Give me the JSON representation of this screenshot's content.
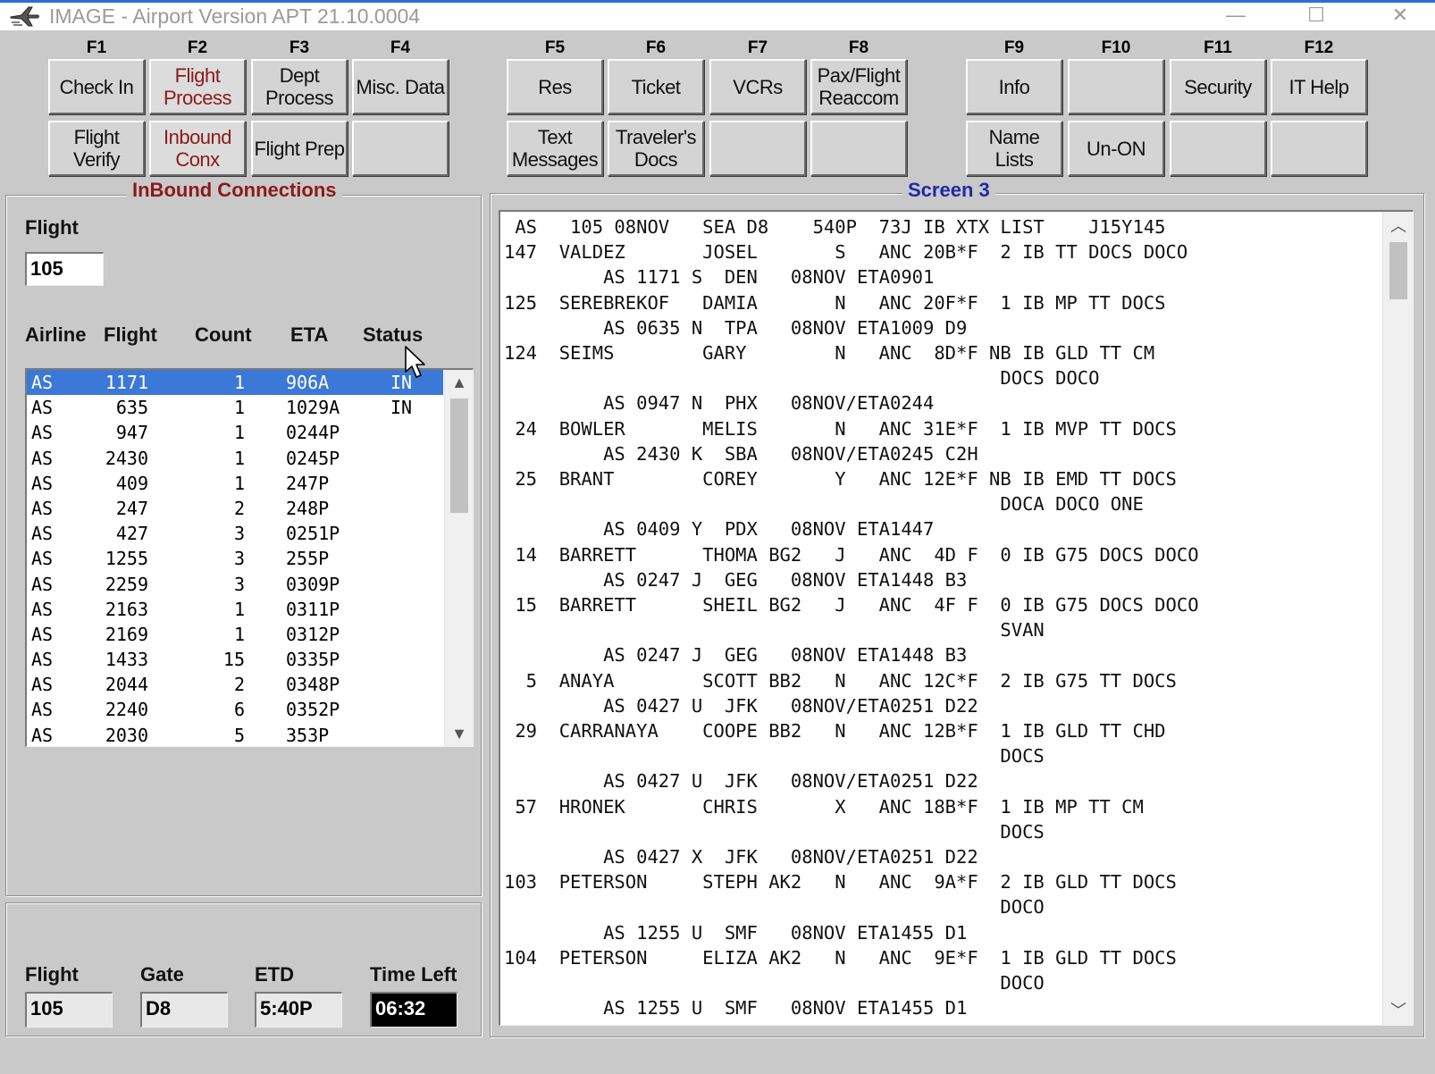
{
  "window": {
    "title": "IMAGE - Airport Version APT 21.10.0004",
    "controls": {
      "minimize": "—",
      "maximize": "☐",
      "close": "✕"
    }
  },
  "function_keys": [
    {
      "key": "F1",
      "top": "Check In",
      "bottom": "Flight\nVerify"
    },
    {
      "key": "F2",
      "top": "Flight\nProcess",
      "bottom": "Inbound\nConx",
      "active": true
    },
    {
      "key": "F3",
      "top": "Dept\nProcess",
      "bottom": "Flight Prep"
    },
    {
      "key": "F4",
      "top": "Misc. Data",
      "bottom": ""
    },
    {
      "key": "F5",
      "top": "Res",
      "bottom": "Text\nMessages"
    },
    {
      "key": "F6",
      "top": "Ticket",
      "bottom": "Traveler's\nDocs"
    },
    {
      "key": "F7",
      "top": "VCRs",
      "bottom": ""
    },
    {
      "key": "F8",
      "top": "Pax/Flight\nReaccom",
      "bottom": ""
    },
    {
      "key": "F9",
      "top": "Info",
      "bottom": "Name\nLists"
    },
    {
      "key": "F10",
      "top": "",
      "bottom": "Un-ON"
    },
    {
      "key": "F11",
      "top": "Security",
      "bottom": ""
    },
    {
      "key": "F12",
      "top": "IT Help",
      "bottom": ""
    }
  ],
  "inbound": {
    "title": "InBound Connections",
    "flight_label": "Flight",
    "flight_value": "105",
    "columns": [
      "Airline",
      "Flight",
      "Count",
      "ETA",
      "Status"
    ],
    "rows": [
      {
        "airline": "AS",
        "flight": "1171",
        "count": "1",
        "eta": "906A",
        "status": "IN",
        "selected": true
      },
      {
        "airline": "AS",
        "flight": "635",
        "count": "1",
        "eta": "1029A",
        "status": "IN"
      },
      {
        "airline": "AS",
        "flight": "947",
        "count": "1",
        "eta": "0244P",
        "status": ""
      },
      {
        "airline": "AS",
        "flight": "2430",
        "count": "1",
        "eta": "0245P",
        "status": ""
      },
      {
        "airline": "AS",
        "flight": "409",
        "count": "1",
        "eta": "247P",
        "status": ""
      },
      {
        "airline": "AS",
        "flight": "247",
        "count": "2",
        "eta": "248P",
        "status": ""
      },
      {
        "airline": "AS",
        "flight": "427",
        "count": "3",
        "eta": "0251P",
        "status": ""
      },
      {
        "airline": "AS",
        "flight": "1255",
        "count": "3",
        "eta": "255P",
        "status": ""
      },
      {
        "airline": "AS",
        "flight": "2259",
        "count": "3",
        "eta": "0309P",
        "status": ""
      },
      {
        "airline": "AS",
        "flight": "2163",
        "count": "1",
        "eta": "0311P",
        "status": ""
      },
      {
        "airline": "AS",
        "flight": "2169",
        "count": "1",
        "eta": "0312P",
        "status": ""
      },
      {
        "airline": "AS",
        "flight": "1433",
        "count": "15",
        "eta": "0335P",
        "status": ""
      },
      {
        "airline": "AS",
        "flight": "2044",
        "count": "2",
        "eta": "0348P",
        "status": ""
      },
      {
        "airline": "AS",
        "flight": "2240",
        "count": "6",
        "eta": "0352P",
        "status": ""
      },
      {
        "airline": "AS",
        "flight": "2030",
        "count": "5",
        "eta": "353P",
        "status": ""
      }
    ]
  },
  "footer": {
    "flight_label": "Flight",
    "flight_value": "105",
    "gate_label": "Gate",
    "gate_value": "D8",
    "etd_label": "ETD",
    "etd_value": "5:40P",
    "time_left_label": "Time Left",
    "time_left_value": "06:32"
  },
  "screen3": {
    "title": "Screen 3",
    "lines": [
      " AS   105 08NOV   SEA D8    540P  73J IB XTX LIST    J15Y145",
      "147  VALDEZ       JOSEL       S   ANC 20B*F  2 IB TT DOCS DOCO",
      "         AS 1171 S  DEN   08NOV ETA0901",
      "125  SEREBREKOF   DAMIA       N   ANC 20F*F  1 IB MP TT DOCS",
      "         AS 0635 N  TPA   08NOV ETA1009 D9",
      "124  SEIMS        GARY        N   ANC  8D*F NB IB GLD TT CM",
      "                                             DOCS DOCO",
      "         AS 0947 N  PHX   08NOV/ETA0244",
      " 24  BOWLER       MELIS       N   ANC 31E*F  1 IB MVP TT DOCS",
      "         AS 2430 K  SBA   08NOV/ETA0245 C2H",
      " 25  BRANT        COREY       Y   ANC 12E*F NB IB EMD TT DOCS",
      "                                             DOCA DOCO ONE",
      "         AS 0409 Y  PDX   08NOV ETA1447",
      " 14  BARRETT      THOMA BG2   J   ANC  4D F  0 IB G75 DOCS DOCO",
      "         AS 0247 J  GEG   08NOV ETA1448 B3",
      " 15  BARRETT      SHEIL BG2   J   ANC  4F F  0 IB G75 DOCS DOCO",
      "                                             SVAN",
      "         AS 0247 J  GEG   08NOV ETA1448 B3",
      "  5  ANAYA        SCOTT BB2   N   ANC 12C*F  2 IB G75 TT DOCS",
      "         AS 0427 U  JFK   08NOV/ETA0251 D22",
      " 29  CARRANAYA    COOPE BB2   N   ANC 12B*F  1 IB GLD TT CHD",
      "                                             DOCS",
      "         AS 0427 U  JFK   08NOV/ETA0251 D22",
      " 57  HRONEK       CHRIS       X   ANC 18B*F  1 IB MP TT CM",
      "                                             DOCS",
      "         AS 0427 X  JFK   08NOV/ETA0251 D22",
      "103  PETERSON     STEPH AK2   N   ANC  9A*F  2 IB GLD TT DOCS",
      "                                             DOCO",
      "         AS 1255 U  SMF   08NOV ETA1455 D1",
      "104  PETERSON     ELIZA AK2   N   ANC  9E*F  1 IB GLD TT DOCS",
      "                                             DOCO",
      "         AS 1255 U  SMF   08NOV ETA1455 D1"
    ]
  },
  "icons": {
    "app": "airplane-icon",
    "scroll_up": "▲",
    "scroll_down": "▼",
    "scroll_up_glyph": "︿",
    "scroll_down_glyph": "﹀"
  }
}
